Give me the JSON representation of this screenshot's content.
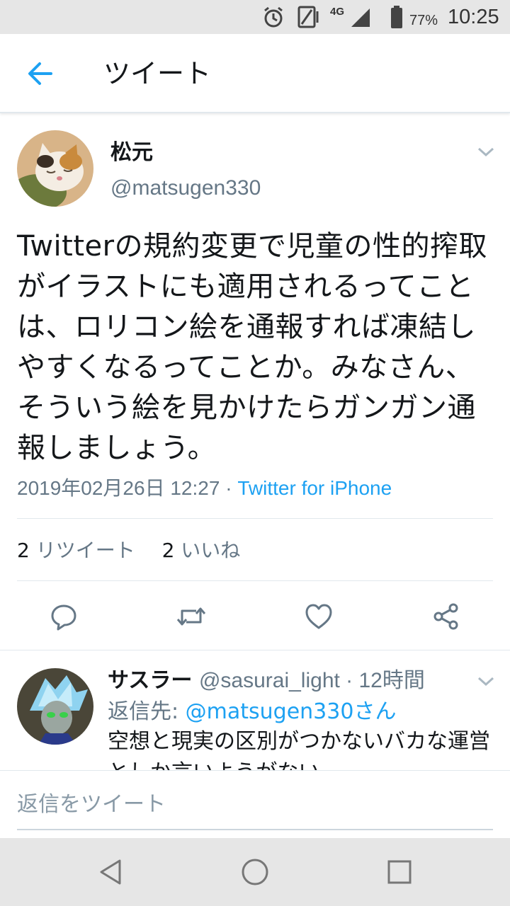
{
  "status_bar": {
    "network": "4G",
    "battery": "77%",
    "time": "10:25",
    "icons": [
      "alarm-icon",
      "screen-icon",
      "signal-icon",
      "battery-icon"
    ]
  },
  "header": {
    "title": "ツイート",
    "back_icon": "arrow-left-icon",
    "accent": "#1da1f2"
  },
  "tweet": {
    "name": "松元",
    "handle": "@matsugen330",
    "text": "Twitterの規約変更で児童の性的搾取がイラストにも適用されるってことは、ロリコン絵を通報すれば凍結しやすくなるってことか。みなさん、そういう絵を見かけたらガンガン通報しましょう。",
    "date": "2019年02月26日 12:27",
    "separator": "·",
    "source": "Twitter for iPhone",
    "retweet_count": "2",
    "retweet_label": "リツイート",
    "like_count": "2",
    "like_label": "いいね",
    "actions": [
      "reply-icon",
      "retweet-icon",
      "like-icon",
      "share-icon"
    ]
  },
  "reply": {
    "name": "サスラー",
    "handle_time": "@sasurai_light · 12時間",
    "reply_label": "返信先:",
    "reply_user": "@matsugen330さん",
    "text": "空想と現実の区別がつかないバカな運営としか言いようがない"
  },
  "compose": {
    "placeholder": "返信をツイート"
  },
  "nav_bar": {
    "icons": [
      "back-triangle-icon",
      "home-circle-icon",
      "recents-square-icon"
    ]
  }
}
